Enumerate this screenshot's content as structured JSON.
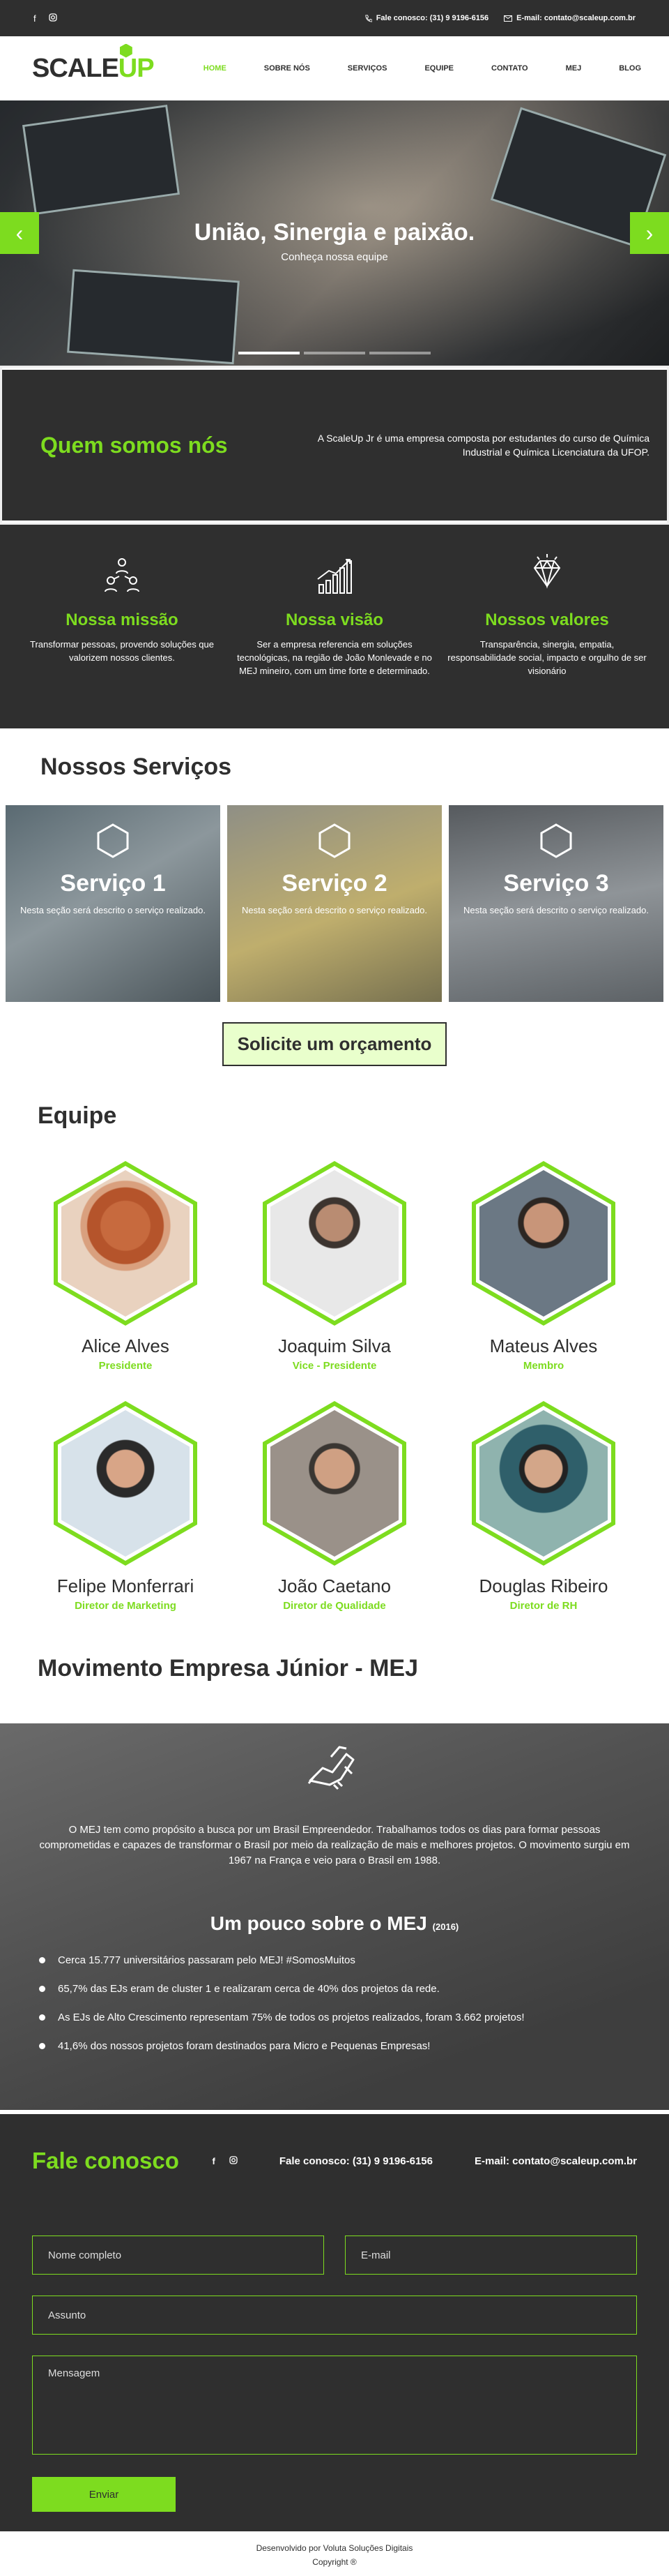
{
  "topbar": {
    "phone": "Fale conosco: (31) 9 9196-6156",
    "email": "E-mail: contato@scaleup.com.br"
  },
  "brand": {
    "logo_a": "SCALE",
    "logo_b": "UP"
  },
  "nav": {
    "items": [
      {
        "label": "HOME"
      },
      {
        "label": "SOBRE NÓS"
      },
      {
        "label": "SERVIÇOS"
      },
      {
        "label": "EQUIPE"
      },
      {
        "label": "CONTATO"
      },
      {
        "label": "MEJ"
      },
      {
        "label": "BLOG"
      }
    ]
  },
  "hero": {
    "title": "União, Sinergia e paixão.",
    "subtitle": "Conheça nossa equipe",
    "prev_icon": "‹",
    "next_icon": "›"
  },
  "about": {
    "title": "Quem somos nós",
    "text": "A ScaleUp Jr é uma empresa composta por estudantes do curso de Química Industrial e Química Licenciatura da UFOP."
  },
  "mission": [
    {
      "title": "Nossa missão",
      "text": "Transformar pessoas, provendo soluções que valorizem nossos clientes.",
      "icon": "people-icon"
    },
    {
      "title": "Nossa visão",
      "text": "Ser a empresa referencia em soluções tecnológicas, na região de João Monlevade e no MEJ mineiro, com um time forte e determinado.",
      "icon": "growth-chart-icon"
    },
    {
      "title": "Nossos valores",
      "text": "Transparência, sinergia, empatia, responsabilidade social, impacto e orgulho de ser visionário",
      "icon": "diamond-icon"
    }
  ],
  "services": {
    "title": "Nossos Serviços",
    "items": [
      {
        "title": "Serviço 1",
        "text": "Nesta seção será descrito o serviço realizado."
      },
      {
        "title": "Serviço 2",
        "text": "Nesta seção será descrito o serviço realizado."
      },
      {
        "title": "Serviço 3",
        "text": "Nesta seção será descrito o serviço realizado."
      }
    ],
    "cta": "Solicite um orçamento"
  },
  "team": {
    "title": "Equipe",
    "members": [
      {
        "name": "Alice Alves",
        "role": "Presidente"
      },
      {
        "name": "Joaquim Silva",
        "role": "Vice - Presidente"
      },
      {
        "name": "Mateus Alves",
        "role": "Membro"
      },
      {
        "name": "Felipe Monferrari",
        "role": "Diretor de Marketing"
      },
      {
        "name": "João Caetano",
        "role": "Diretor de Qualidade"
      },
      {
        "name": "Douglas Ribeiro",
        "role": "Diretor de RH"
      }
    ]
  },
  "mej": {
    "title": "Movimento Empresa Júnior - MEJ",
    "intro": "O MEJ tem como propósito a busca por um Brasil Empreendedor. Trabalhamos todos os dias para formar pessoas comprometidas e capazes de transformar o Brasil por meio da realização de mais e melhores projetos. O movimento surgiu em 1967 na França e veio para o Brasil em 1988.",
    "subtitle": "Um pouco sobre o MEJ",
    "subtitle_year": "(2016)",
    "facts": [
      "Cerca 15.777 universitários passaram pelo MEJ! #SomosMuitos",
      "65,7% das EJs eram de cluster 1 e realizaram cerca de 40% dos projetos da rede.",
      "As EJs de Alto Crescimento representam 75% de todos os projetos realizados, foram 3.662 projetos!",
      "41,6% dos nossos projetos foram destinados para Micro e Pequenas Empresas!"
    ]
  },
  "contact": {
    "title": "Fale conosco",
    "phone": "Fale conosco: (31) 9 9196-6156",
    "email": "E-mail: contato@scaleup.com.br",
    "name_placeholder": "Nome completo",
    "email_placeholder": "E-mail",
    "subject_placeholder": "Assunto",
    "message_placeholder": "Mensagem",
    "send": "Enviar"
  },
  "footer": {
    "dev": "Desenvolvido por Voluta Soluções Digitais",
    "copyright": "Copyright ®"
  },
  "colors": {
    "accent": "#7ddc1f",
    "dark": "#2f2f2f"
  }
}
